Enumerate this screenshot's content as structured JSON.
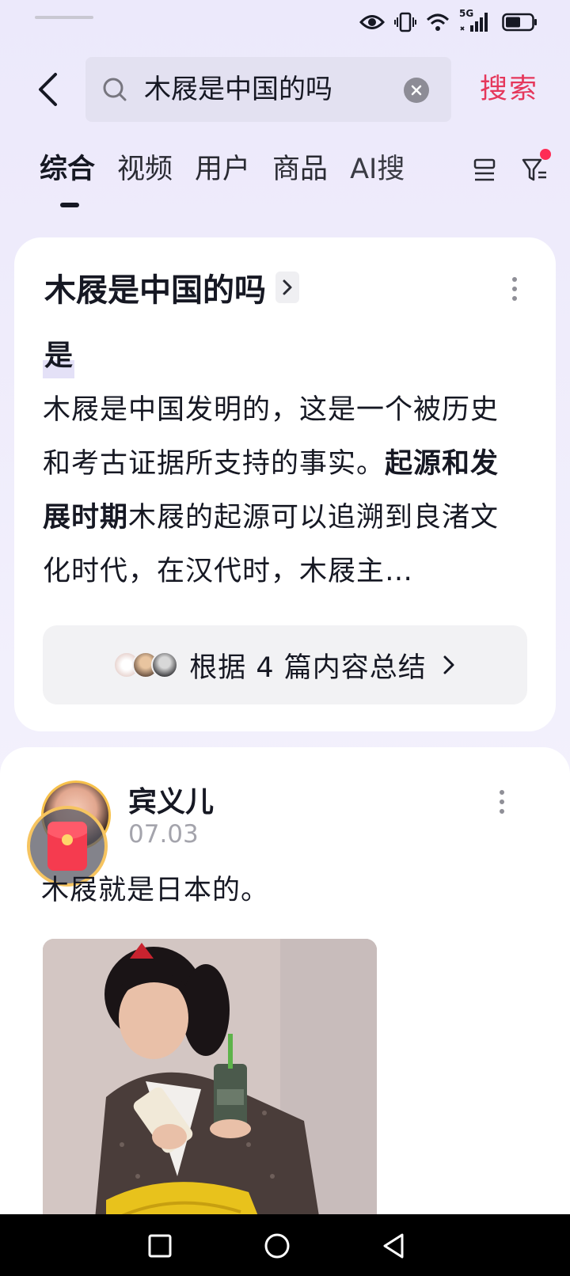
{
  "status_bar": {
    "network_label": "5G",
    "icons": [
      "eye-icon",
      "vibrate-icon",
      "wifi-icon",
      "signal-icon",
      "battery-icon"
    ]
  },
  "search": {
    "query": "木屐是中国的吗",
    "submit_label": "搜索"
  },
  "tabs": [
    {
      "label": "综合",
      "active": true
    },
    {
      "label": "视频",
      "active": false
    },
    {
      "label": "用户",
      "active": false
    },
    {
      "label": "商品",
      "active": false
    },
    {
      "label": "AI搜",
      "active": false
    }
  ],
  "ai_card": {
    "title": "木屐是中国的吗",
    "short_answer": "是",
    "answer_intro": "木屐是中国发明的，这是一个被历史和考古证据所支持的事实。",
    "answer_bold": "起源和发展时期",
    "answer_rest": "木屐的起源可以追溯到良渚文化时代，在汉代时，木屐主…",
    "summary_label": "根据 4 篇内容总结"
  },
  "post": {
    "author": "宾义儿",
    "date": "07.03",
    "text": "木屐就是日本的。"
  },
  "colors": {
    "accent": "#e5375b",
    "background": "#eeebfb",
    "text": "#161823"
  }
}
